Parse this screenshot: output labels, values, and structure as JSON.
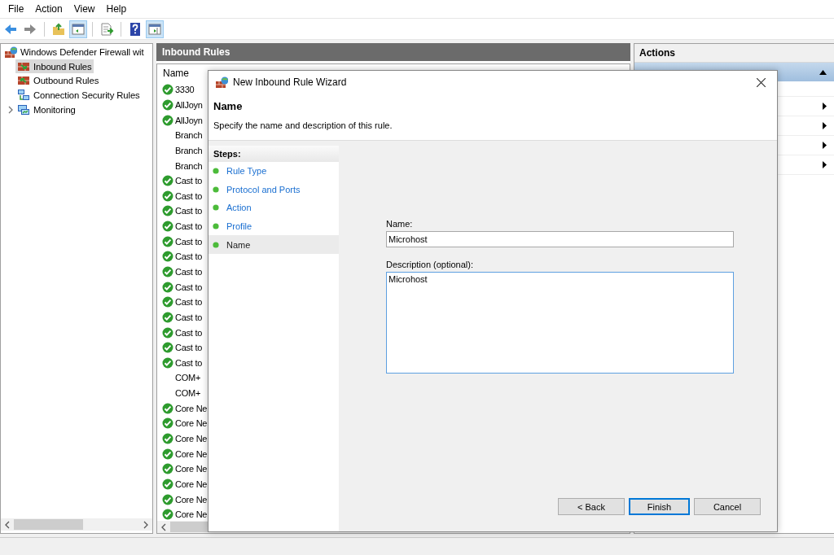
{
  "menu": [
    "File",
    "Action",
    "View",
    "Help"
  ],
  "toolbar": [
    {
      "kind": "back",
      "pressed": false
    },
    {
      "kind": "forward",
      "pressed": false
    },
    {
      "kind": "sep"
    },
    {
      "kind": "up",
      "pressed": false
    },
    {
      "kind": "tree",
      "pressed": true
    },
    {
      "kind": "sep"
    },
    {
      "kind": "export",
      "pressed": false
    },
    {
      "kind": "sep"
    },
    {
      "kind": "help",
      "pressed": false
    },
    {
      "kind": "pane",
      "pressed": true
    }
  ],
  "tree": {
    "items": [
      {
        "label": "Windows Defender Firewall wit",
        "kind": "firewall",
        "selected": false,
        "children": [
          {
            "label": "Inbound Rules",
            "kind": "inbound",
            "selected": true
          },
          {
            "label": "Outbound Rules",
            "kind": "outbound",
            "selected": false
          },
          {
            "label": "Connection Security Rules",
            "kind": "security",
            "selected": false
          },
          {
            "label": "Monitoring",
            "kind": "monitor",
            "selected": false,
            "expanded": false
          }
        ]
      }
    ]
  },
  "rules": {
    "title": "Inbound Rules",
    "column_1": "Name",
    "rows": [
      {
        "name": "3330",
        "enabled": true
      },
      {
        "name": "AllJoyn",
        "enabled": true
      },
      {
        "name": "AllJoyn",
        "enabled": true
      },
      {
        "name": "Branch",
        "enabled": false
      },
      {
        "name": "Branch",
        "enabled": false
      },
      {
        "name": "Branch",
        "enabled": false
      },
      {
        "name": "Cast to",
        "enabled": true
      },
      {
        "name": "Cast to",
        "enabled": true
      },
      {
        "name": "Cast to",
        "enabled": true
      },
      {
        "name": "Cast to",
        "enabled": true
      },
      {
        "name": "Cast to",
        "enabled": true
      },
      {
        "name": "Cast to",
        "enabled": true
      },
      {
        "name": "Cast to",
        "enabled": true
      },
      {
        "name": "Cast to",
        "enabled": true
      },
      {
        "name": "Cast to",
        "enabled": true
      },
      {
        "name": "Cast to",
        "enabled": true
      },
      {
        "name": "Cast to",
        "enabled": true
      },
      {
        "name": "Cast to",
        "enabled": true
      },
      {
        "name": "Cast to",
        "enabled": true
      },
      {
        "name": "COM+",
        "enabled": false
      },
      {
        "name": "COM+",
        "enabled": false
      },
      {
        "name": "Core Ne",
        "enabled": true
      },
      {
        "name": "Core Ne",
        "enabled": true
      },
      {
        "name": "Core Ne",
        "enabled": true
      },
      {
        "name": "Core Ne",
        "enabled": true
      },
      {
        "name": "Core Ne",
        "enabled": true
      },
      {
        "name": "Core Ne",
        "enabled": true
      },
      {
        "name": "Core Ne",
        "enabled": true
      },
      {
        "name": "Core Ne",
        "enabled": true
      }
    ]
  },
  "actions": {
    "title": "Actions"
  },
  "wizard": {
    "title": "New Inbound Rule Wizard",
    "heading": "Name",
    "subtitle": "Specify the name and description of this rule.",
    "steps_title": "Steps:",
    "steps": [
      {
        "label": "Rule Type",
        "selected": false
      },
      {
        "label": "Protocol and Ports",
        "selected": false
      },
      {
        "label": "Action",
        "selected": false
      },
      {
        "label": "Profile",
        "selected": false
      },
      {
        "label": "Name",
        "selected": true
      }
    ],
    "name_label": "Name:",
    "name_value": "Microhost",
    "description_label": "Description (optional):",
    "description_value": "Microhost",
    "buttons": [
      {
        "label": "< Back",
        "default": false
      },
      {
        "label": "Finish",
        "default": true
      },
      {
        "label": "Cancel",
        "default": false
      }
    ]
  }
}
